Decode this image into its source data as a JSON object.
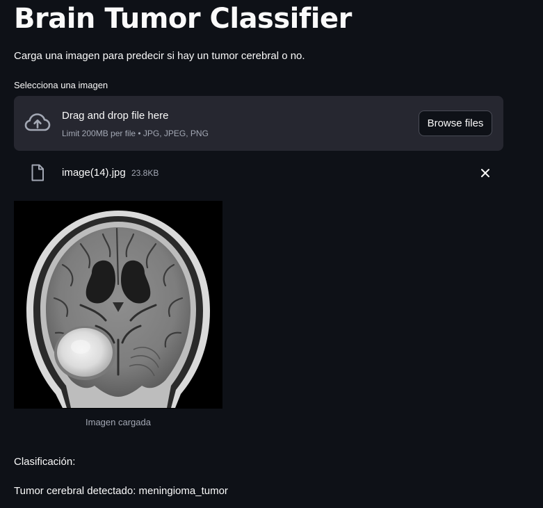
{
  "page": {
    "title": "Brain Tumor Classifier",
    "subtitle": "Carga una imagen para predecir si hay un tumor cerebral o no."
  },
  "uploader": {
    "label": "Selecciona una imagen",
    "drop_text": "Drag and drop file here",
    "limit_text": "Limit 200MB per file • JPG, JPEG, PNG",
    "browse_label": "Browse files",
    "upload_icon": "cloud-upload-icon"
  },
  "file": {
    "name": "image(14).jpg",
    "size": "23.8KB",
    "file_icon": "file-icon",
    "remove_icon": "close-icon"
  },
  "image": {
    "caption": "Imagen cargada"
  },
  "result": {
    "label": "Clasificación:",
    "text": "Tumor cerebral detectado: meningioma_tumor"
  },
  "colors": {
    "background": "#0e1117",
    "dropzone": "#262730",
    "text": "#fafafa",
    "muted": "#a3a8b4"
  }
}
